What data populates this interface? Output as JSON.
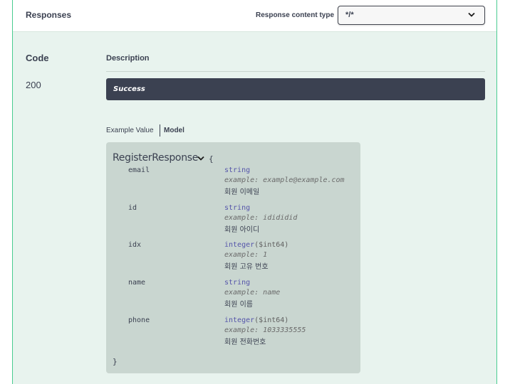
{
  "responses": {
    "title": "Responses",
    "content_type_label": "Response content type",
    "content_type_value": "*/*"
  },
  "table": {
    "col_code": "Code",
    "col_description": "Description"
  },
  "response": {
    "code": "200",
    "description": "Success"
  },
  "tabs": {
    "example_value": "Example Value",
    "model": "Model"
  },
  "model": {
    "name": "RegisterResponse",
    "open_brace": "{",
    "close_brace": "}",
    "properties": [
      {
        "name": "email",
        "type": "string",
        "format": "",
        "example": "example: example@example.com",
        "description": "회원 이메일"
      },
      {
        "name": "id",
        "type": "string",
        "format": "",
        "example": "example: idididid",
        "description": "회원 아이디"
      },
      {
        "name": "idx",
        "type": "integer",
        "format": "($int64)",
        "example": "example: 1",
        "description": "회원 고유 번호"
      },
      {
        "name": "name",
        "type": "string",
        "format": "",
        "example": "example: name",
        "description": "회원 이름"
      },
      {
        "name": "phone",
        "type": "integer",
        "format": "($int64)",
        "example": "example: 1033335555",
        "description": "회원 전화번호"
      }
    ]
  },
  "colors": {
    "accent": "#49cc90",
    "panel_bg": "#e8f3ee",
    "success_bar": "#3b4151",
    "model_bg": "#c9d6d0",
    "type_color": "#5555aa"
  }
}
